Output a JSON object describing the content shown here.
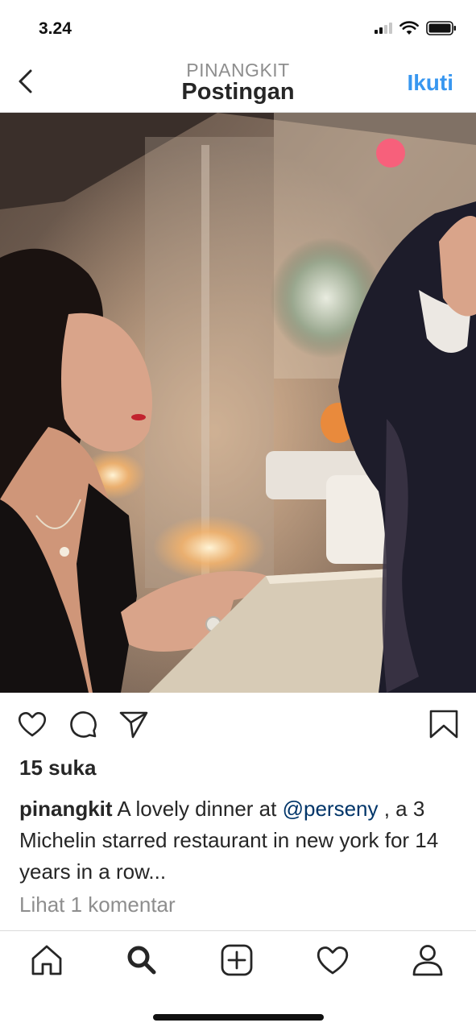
{
  "status_bar": {
    "time": "3.24"
  },
  "header": {
    "username": "PINANGKIT",
    "title": "Postingan",
    "follow_label": "Ikuti"
  },
  "post": {
    "likes": "15 suka",
    "caption_user": "pinangkit",
    "caption_text_1": " A lovely dinner at ",
    "caption_mention": "@perseny",
    "caption_text_2": " , a 3 Michelin starred restaurant in new york for 14 years in a row...",
    "comments_link": "Lihat 1 komentar"
  },
  "icons": {
    "back": "chevron-left-icon",
    "like": "heart-icon",
    "comment": "comment-icon",
    "share": "paper-plane-icon",
    "save": "bookmark-icon",
    "tabs": [
      "home-icon",
      "search-icon",
      "add-post-icon",
      "activity-heart-icon",
      "profile-icon"
    ]
  },
  "colors": {
    "accent": "#3897f0",
    "mention": "#003569",
    "muted": "#8e8e8e",
    "text": "#262626"
  }
}
